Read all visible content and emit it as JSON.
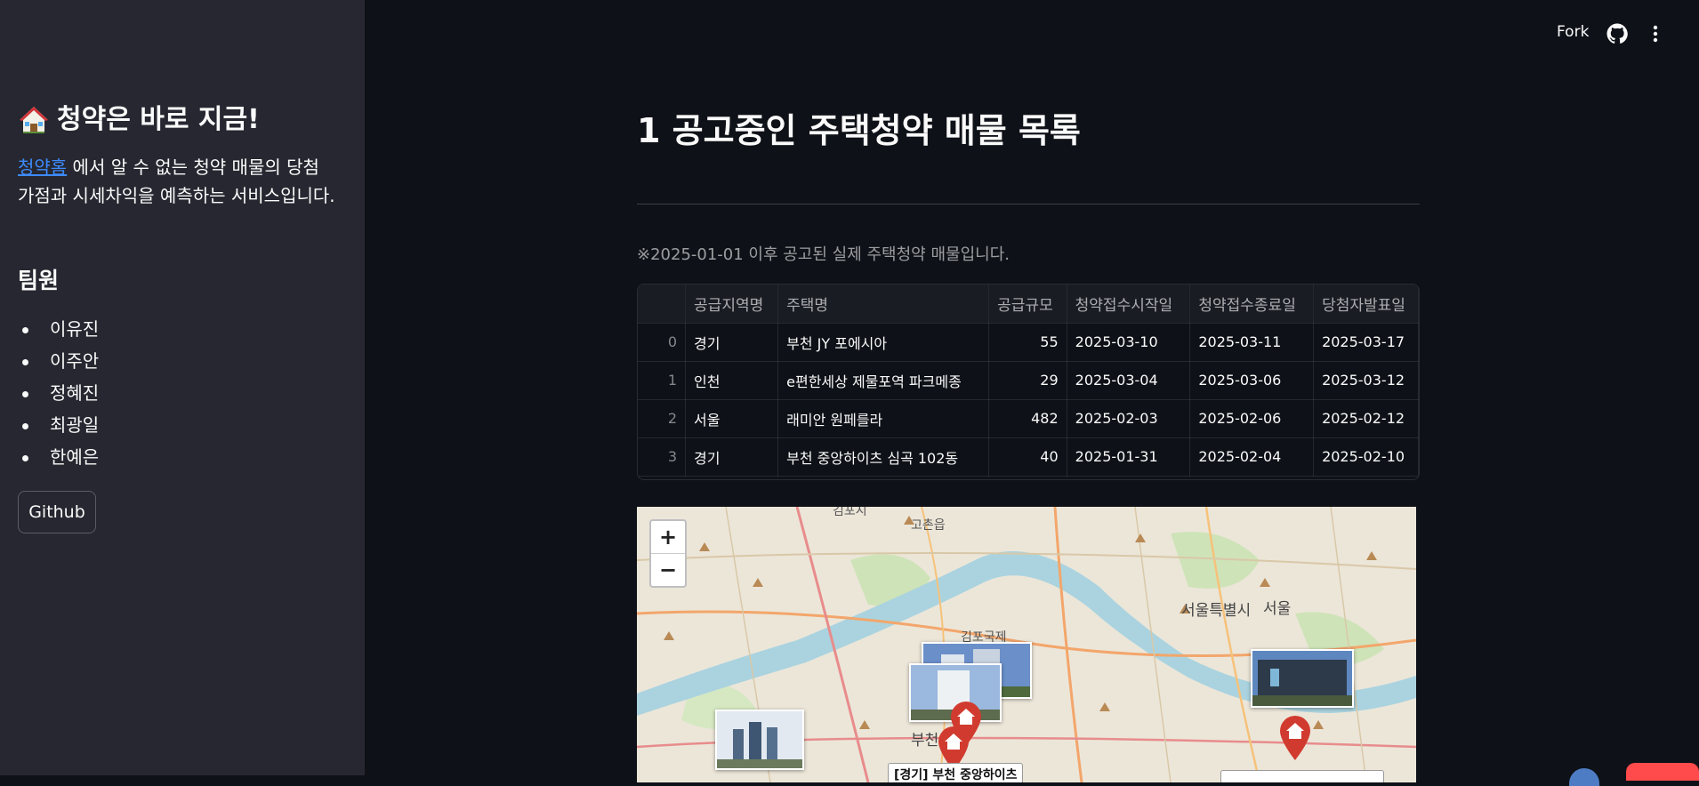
{
  "sidebar": {
    "title": "청약은 바로 지금!",
    "title_icon": "house-emoji",
    "link_text": "청약홈",
    "description_rest": " 에서 알 수 없는 청약 매물의 당첨 가점과 시세차익을 예측하는 서비스입니다.",
    "team_heading": "팀원",
    "members": [
      "이유진",
      "이주안",
      "정혜진",
      "최광일",
      "한예은"
    ],
    "github_button": "Github"
  },
  "header": {
    "fork_label": "Fork",
    "icons": [
      "github-icon",
      "more-vertical-icon"
    ]
  },
  "main": {
    "title": "1 공고중인 주택청약 매물 목록",
    "caption": "※2025-01-01 이후 공고된 실제 주택청약 매물입니다.",
    "table": {
      "columns": [
        "",
        "공급지역명",
        "주택명",
        "공급규모",
        "청약접수시작일",
        "청약접수종료일",
        "당첨자발표일"
      ],
      "rows": [
        [
          "0",
          "경기",
          "부천 JY 포에시아",
          "55",
          "2025-03-10",
          "2025-03-11",
          "2025-03-17"
        ],
        [
          "1",
          "인천",
          "e편한세상 제물포역 파크메종",
          "29",
          "2025-03-04",
          "2025-03-06",
          "2025-03-12"
        ],
        [
          "2",
          "서울",
          "래미안 원페를라",
          "482",
          "2025-02-03",
          "2025-02-06",
          "2025-02-12"
        ],
        [
          "3",
          "경기",
          "부천 중앙하이츠 심곡 102동",
          "40",
          "2025-01-31",
          "2025-02-04",
          "2025-02-10"
        ]
      ]
    },
    "map": {
      "zoom_in": "+",
      "zoom_out": "−",
      "labels": {
        "gochon": "고촌읍",
        "gimpo_airport": "김포국제",
        "seoul_special": "서울특별시",
        "seoul": "서울",
        "bucheon": "부천",
        "top_cut": "김포시"
      },
      "tooltip": "[경기] 부천 중앙하이츠"
    }
  }
}
